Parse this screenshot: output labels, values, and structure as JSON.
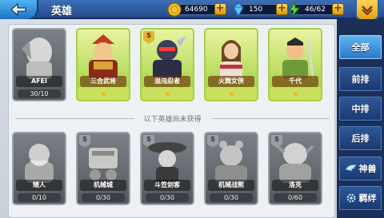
{
  "topbar": {
    "title": "英雄",
    "gold": "64690",
    "diamonds": "150",
    "energy": "46/62"
  },
  "tabs": [
    {
      "label": "全部",
      "active": true
    },
    {
      "label": "前排",
      "active": false
    },
    {
      "label": "中排",
      "active": false
    },
    {
      "label": "后排",
      "active": false
    },
    {
      "label": "神兽",
      "active": false
    },
    {
      "label": "羁绊",
      "active": false
    }
  ],
  "divider_text": "以下英雄尚未获得",
  "owned_heroes": [
    {
      "badge": "",
      "name": "AFEI",
      "footer": "30/10",
      "owned": false
    },
    {
      "badge": "",
      "name": "三合武将",
      "owned": true,
      "stars": 1
    },
    {
      "badge": "S",
      "name": "混沌忍者",
      "owned": true,
      "stars": 1
    },
    {
      "badge": "",
      "name": "火舞女侠",
      "owned": true,
      "stars": 1
    },
    {
      "badge": "",
      "name": "千代",
      "owned": true,
      "stars": 1
    }
  ],
  "locked_heroes": [
    {
      "badge": "",
      "name": "矮人",
      "footer": "0/10"
    },
    {
      "badge": "S",
      "name": "机械城",
      "footer": "0/30"
    },
    {
      "badge": "S",
      "name": "斗笠剑客",
      "footer": "0/30"
    },
    {
      "badge": "S",
      "name": "机械战熊",
      "footer": "0/30"
    },
    {
      "badge": "S",
      "name": "洛克",
      "footer": "0/60"
    }
  ],
  "colors": {
    "accent": "#2b78c8",
    "owned_card": "#9ccd38",
    "gold_plus": "#e0a114"
  }
}
